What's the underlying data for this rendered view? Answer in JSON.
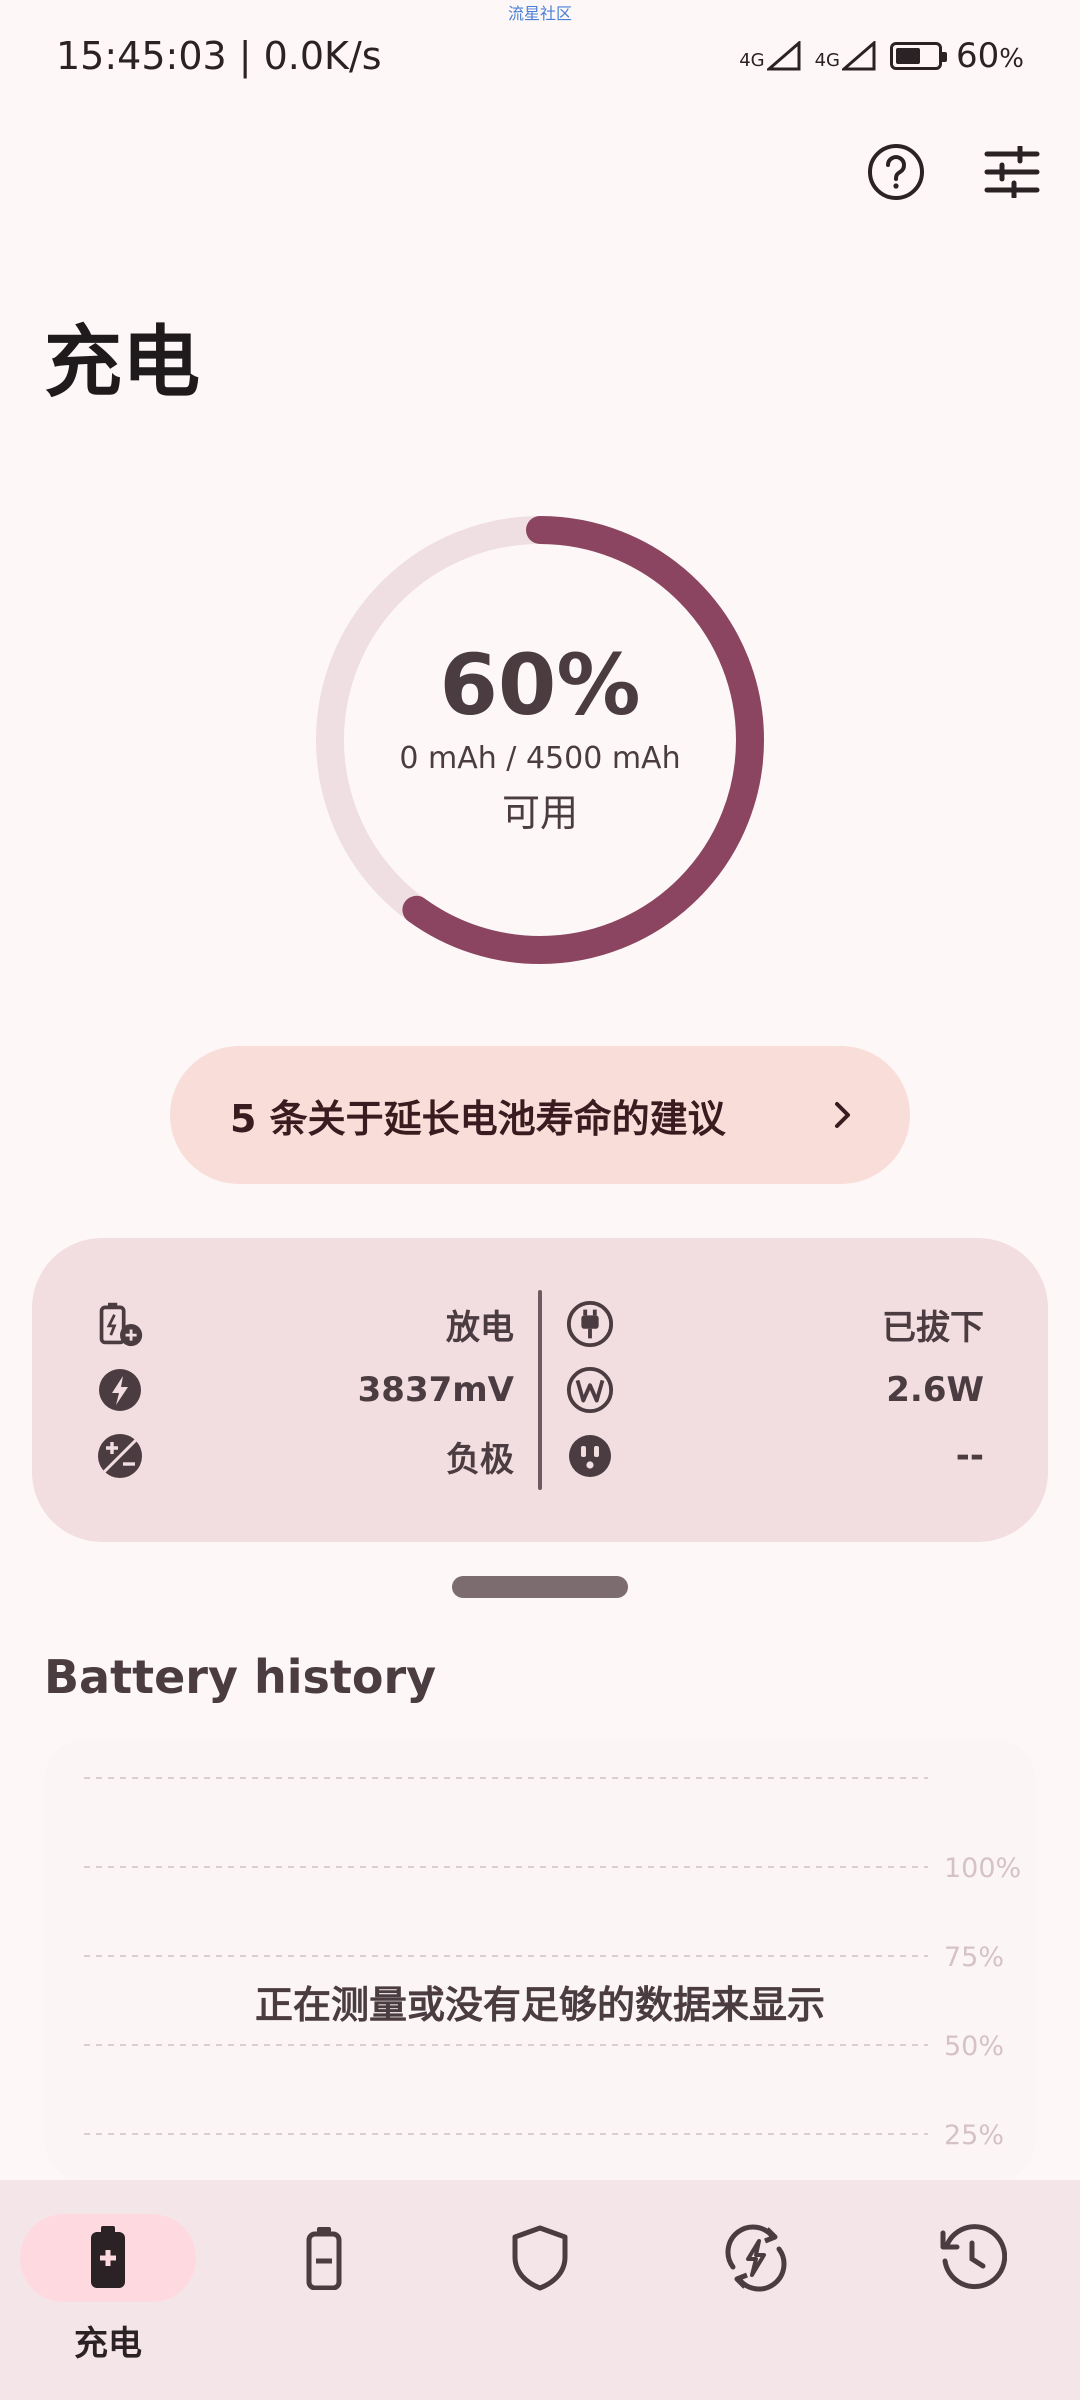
{
  "status_bar": {
    "time_speed": "15:45:03 | 0.0K/s",
    "network_1": "4G",
    "network_2": "4G",
    "battery": "60",
    "battery_unit": "%",
    "top_label": "流星社区"
  },
  "page": {
    "title": "充电"
  },
  "gauge": {
    "percent_label": "60%",
    "level": 0.6,
    "capacity": "0 mAh / 4500 mAh",
    "status": "可用"
  },
  "tips": {
    "label": "5 条关于延长电池寿命的建议"
  },
  "info": {
    "left": [
      {
        "icon": "battery-charge-plus-icon",
        "value": "放电"
      },
      {
        "icon": "bolt-icon",
        "value": "3837mV"
      },
      {
        "icon": "plus-minus-icon",
        "value": "负极"
      }
    ],
    "right": [
      {
        "icon": "plug-icon",
        "value": "已拔下"
      },
      {
        "icon": "watt-icon",
        "value": "2.6W"
      },
      {
        "icon": "outlet-icon",
        "value": "--"
      }
    ]
  },
  "history": {
    "title": "Battery history",
    "empty_message": "正在测量或没有足够的数据来显示",
    "y_ticks": [
      "100%",
      "75%",
      "50%",
      "25%"
    ]
  },
  "nav": {
    "items": [
      {
        "icon": "battery-plus-icon",
        "label": "充电",
        "active": true
      },
      {
        "icon": "battery-icon",
        "label": ""
      },
      {
        "icon": "shield-icon",
        "label": ""
      },
      {
        "icon": "bolt-cycle-icon",
        "label": ""
      },
      {
        "icon": "history-icon",
        "label": ""
      }
    ]
  },
  "colors": {
    "accent": "#8b4560",
    "ring_track": "#f0dfe2",
    "card_bg": "#f2dde1",
    "tips_bg": "#f8ddd8",
    "nav_bg": "#f4e6e8",
    "nav_active": "#ffd9e0"
  }
}
